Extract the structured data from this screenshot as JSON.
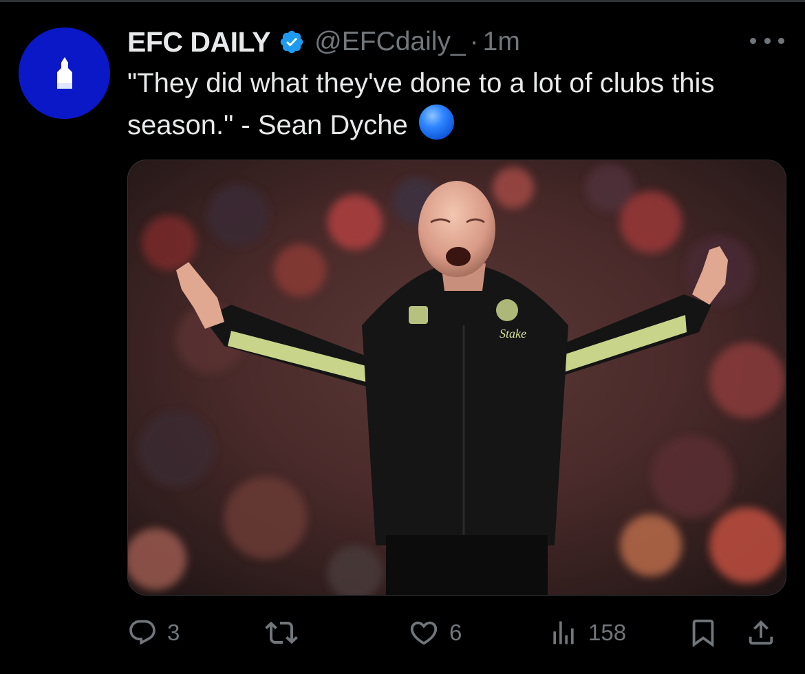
{
  "post": {
    "display_name": "EFC DAILY",
    "handle": "@EFCdaily_",
    "separator": "·",
    "time": "1m",
    "text": "\"They did what they've done to a lot of clubs this season.\" - Sean Dyche",
    "emoji": "blue-circle",
    "media_alt": "Photo of a football manager shouting on the touchline, arms raised, in front of a stadium crowd",
    "jacket_text": "Stake"
  },
  "actions": {
    "replies": "3",
    "retweets": "",
    "likes": "6",
    "views": "158"
  },
  "icons": {
    "verified": "verified-badge-icon",
    "more": "more-options-icon",
    "reply": "reply-icon",
    "retweet": "retweet-icon",
    "like": "heart-icon",
    "views": "views-chart-icon",
    "bookmark": "bookmark-icon",
    "share": "share-icon"
  },
  "colors": {
    "background": "#000000",
    "text_primary": "#e7e9ea",
    "text_secondary": "#71767b",
    "avatar_blue": "#0a18c8",
    "verified_blue": "#1d9bf0"
  }
}
